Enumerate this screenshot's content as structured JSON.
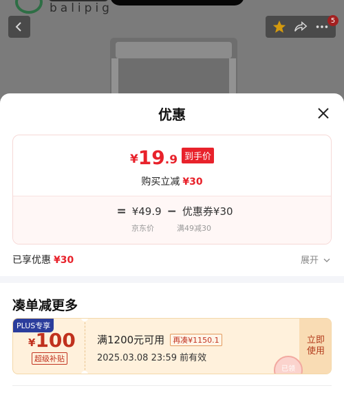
{
  "background": {
    "logo_text": "balipig",
    "badge_count": "5",
    "icons": [
      "back-arrow-icon",
      "star-icon",
      "share-icon",
      "more-icon"
    ]
  },
  "sheet": {
    "title": "优惠",
    "price": {
      "currency": "¥",
      "integer": "19",
      "decimal": ".9",
      "tag": "到手价",
      "save_prefix": "购买立减",
      "save_amount": "¥30"
    },
    "formula": {
      "equals": "=",
      "jd_price": "¥49.9",
      "minus": "−",
      "coupon_label": "优惠券¥30",
      "jd_price_label": "京东价",
      "coupon_rule": "满49减30"
    },
    "enjoyed_prefix": "已享优惠",
    "enjoyed_amount": "¥30",
    "expand_label": "展开",
    "section_title": "凑单减更多",
    "coupon": {
      "plus_tag": "PLUS专享",
      "currency": "¥",
      "value": "100",
      "subsidy": "超级补贴",
      "condition": "满1200元可用",
      "extra": "再凑¥1150.1",
      "expiry": "2025.03.08 23:59 前有效",
      "use_label": "立即使用",
      "stamp": "已领"
    }
  },
  "colors": {
    "accent_red": "#e8222b",
    "plus_blue": "#2b3d9c",
    "coupon_bg": "#fff1dc"
  }
}
